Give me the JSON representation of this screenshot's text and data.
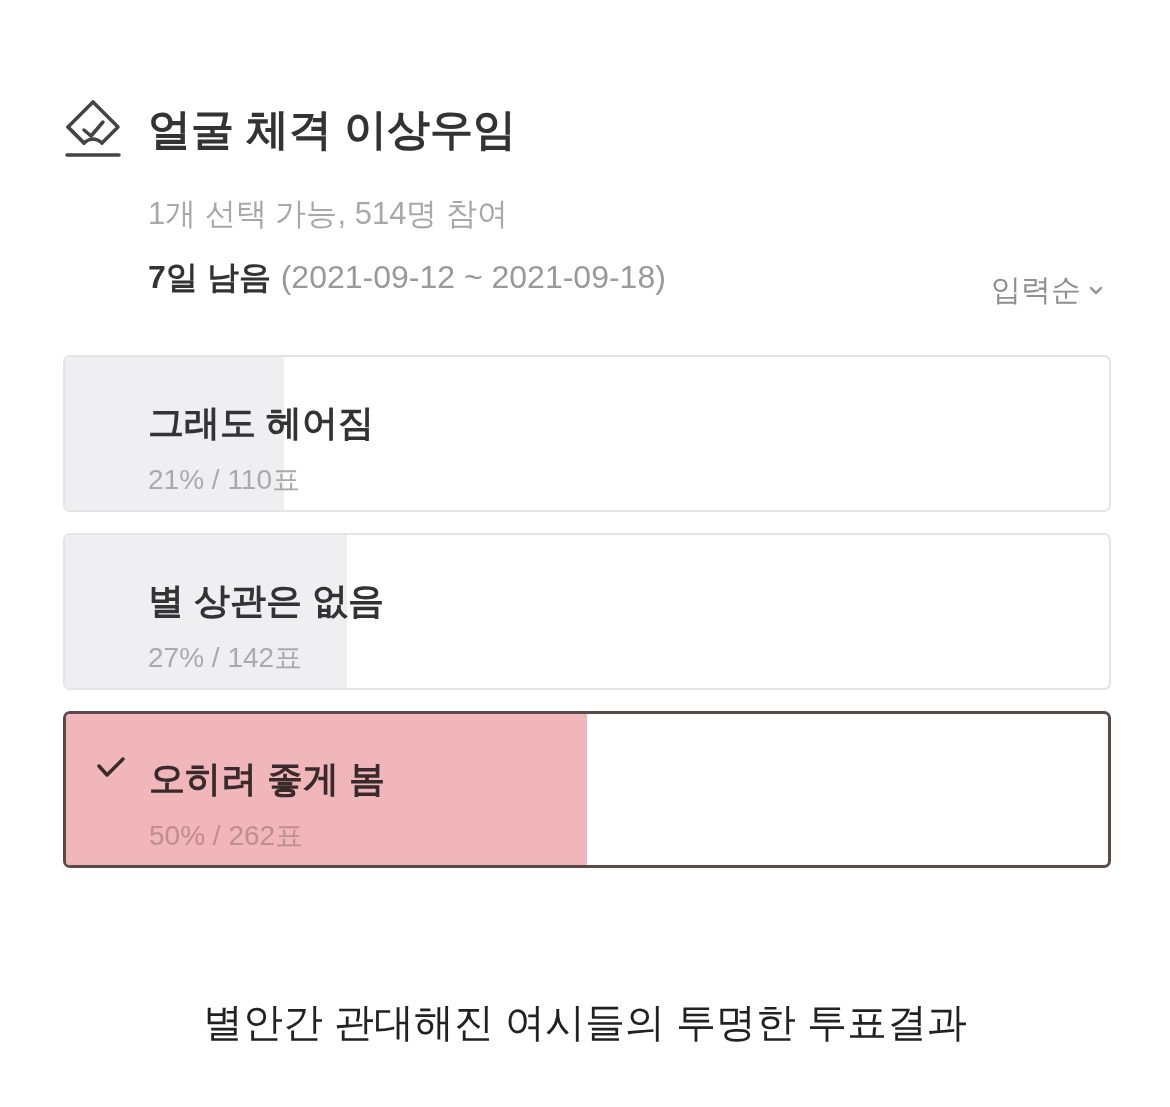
{
  "poll": {
    "title": "얼굴 체격 이상우임",
    "summary": "1개 선택 가능, 514명 참여",
    "remaining": "7일 남음",
    "period": "(2021-09-12 ~ 2021-09-18)",
    "sort": {
      "label": "입력순"
    }
  },
  "options": [
    {
      "label": "그래도 헤어짐",
      "result": "21% / 110표",
      "level": 0.21,
      "selected": false
    },
    {
      "label": "별 상관은 없음",
      "result": "27% / 142표",
      "level": 0.27,
      "selected": false
    },
    {
      "label": "오히려 좋게 봄",
      "result": "50% / 262표",
      "level": 0.5,
      "selected": true
    }
  ],
  "caption": "별안간 관대해진 여시들의 투명한 투표결과"
}
